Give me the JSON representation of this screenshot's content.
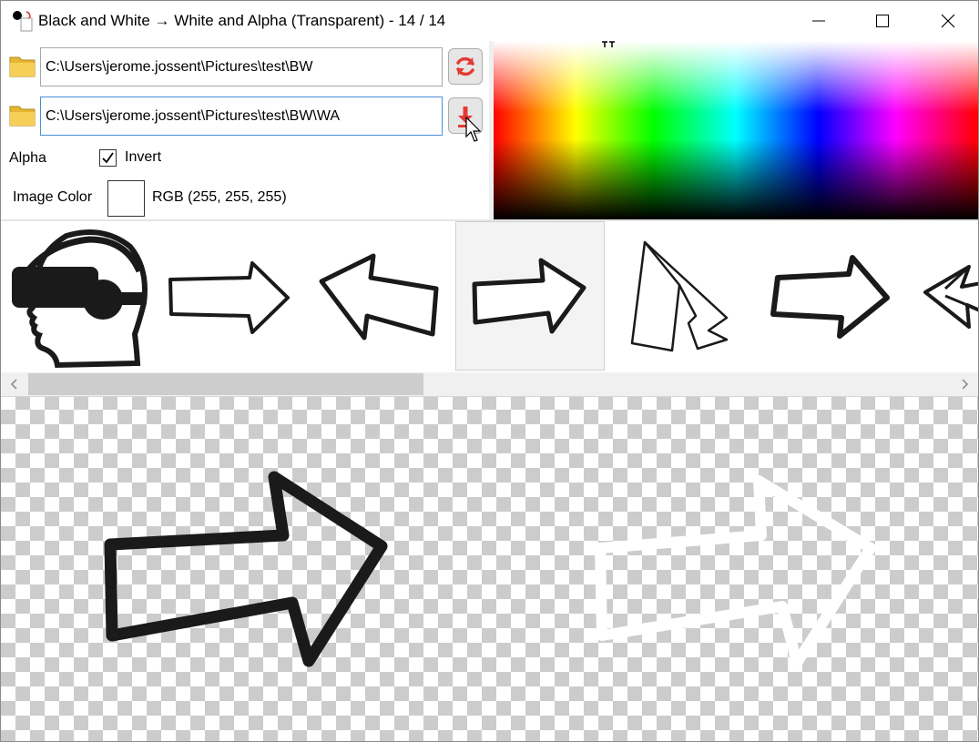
{
  "window": {
    "title": "Black and White → White and Alpha (Transparent) - 14 / 14",
    "controls": [
      "minimize",
      "maximize",
      "close"
    ]
  },
  "source": {
    "path": "C:\\Users\\jerome.jossent\\Pictures\\test\\BW",
    "icon": "folder-icon",
    "button_icon": "refresh-icon",
    "button_color": "#e53935"
  },
  "output": {
    "path": "C:\\Users\\jerome.jossent\\Pictures\\test\\BW\\WA",
    "icon": "folder-icon",
    "button_icon": "download-icon",
    "button_color": "#e53935"
  },
  "alpha": {
    "label": "Alpha",
    "invert_label": "Invert",
    "invert_checked": true
  },
  "image_color": {
    "label": "Image Color",
    "swatch": "#ffffff",
    "value": "RGB (255, 255, 255)"
  },
  "thumbnails": [
    {
      "name": "vr-headset-head"
    },
    {
      "name": "arrow-right-outline"
    },
    {
      "name": "arrow-left-outline"
    },
    {
      "name": "arrow-right-bold",
      "selected": true
    },
    {
      "name": "arrow-up-folded"
    },
    {
      "name": "arrow-right-heavy"
    },
    {
      "name": "arrow-left-partial"
    }
  ],
  "colors": {
    "accent_focus": "#4a90d9",
    "checker_dark": "#cccccc",
    "checker_light": "#ffffff"
  }
}
